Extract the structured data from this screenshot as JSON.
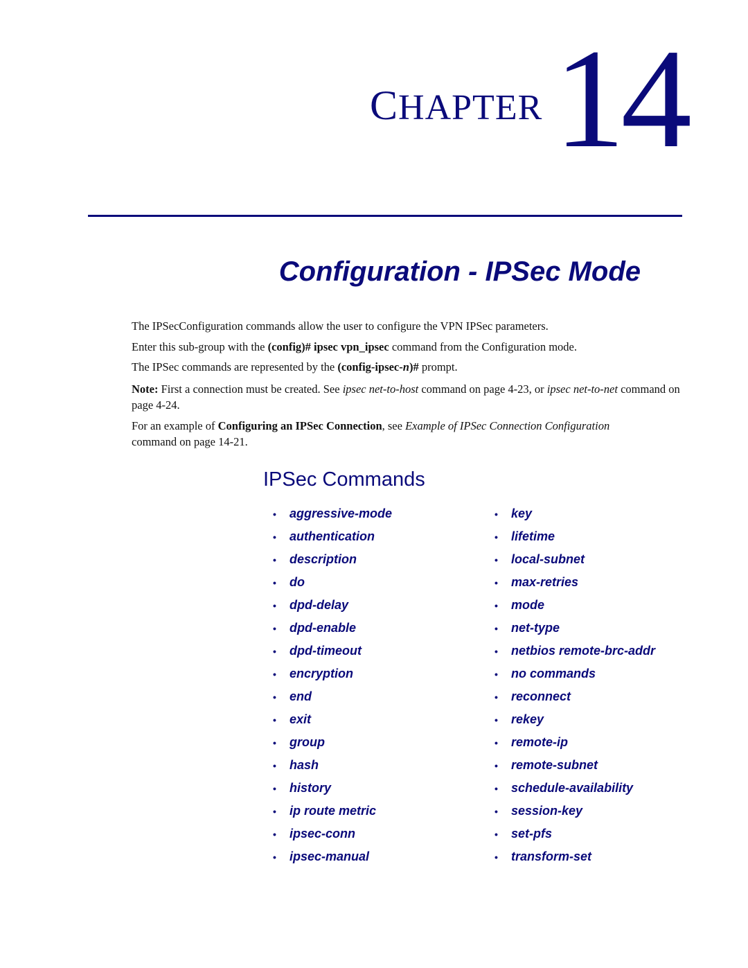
{
  "chapter": {
    "word_first": "C",
    "word_rest": "HAPTER",
    "number": "14"
  },
  "title": "Configuration - IPSec Mode",
  "intro": {
    "p1": "The IPSecConfiguration commands allow the user to configure the VPN IPSec parameters.",
    "p2": {
      "pre": "Enter this sub-group with the ",
      "cmd": "(config)# ipsec vpn_ipsec",
      "post": " command from the Configuration mode."
    },
    "p3": {
      "pre": "The IPSec commands are represented by the ",
      "prompt_a": "(config-ipsec-",
      "prompt_n": "n",
      "prompt_b": ")#",
      "post": " prompt."
    },
    "note": {
      "label": "Note:",
      "text1": " First a connection must be created. See ",
      "ref1": "ipsec net-to-host",
      "text2": " command on page 4-23, or ",
      "ref2": "ipsec net-to-net",
      "text3": " command on page 4-24."
    },
    "example": {
      "pre": "For an example of ",
      "bold": "Configuring an IPSec Connection",
      "mid": ", see ",
      "ref": "Example of IPSec Connection Configuration",
      "post": " command on page 14-21."
    }
  },
  "section": {
    "title": "IPSec Commands",
    "bullet": "•",
    "left_commands": [
      "aggressive-mode",
      "authentication",
      "description",
      "do",
      "dpd-delay",
      "dpd-enable",
      "dpd-timeout",
      "encryption",
      "end",
      "exit",
      "group",
      "hash",
      "history",
      "ip route metric",
      "ipsec-conn",
      "ipsec-manual"
    ],
    "right_commands": [
      "key",
      "lifetime",
      "local-subnet",
      "max-retries",
      "mode",
      "net-type",
      "netbios remote-brc-addr",
      "no commands",
      "reconnect",
      "rekey",
      "remote-ip",
      "remote-subnet",
      "schedule-availability",
      "session-key",
      "set-pfs",
      "transform-set"
    ]
  },
  "colors": {
    "heading": "#0a0a7a",
    "body_text": "#111111"
  }
}
